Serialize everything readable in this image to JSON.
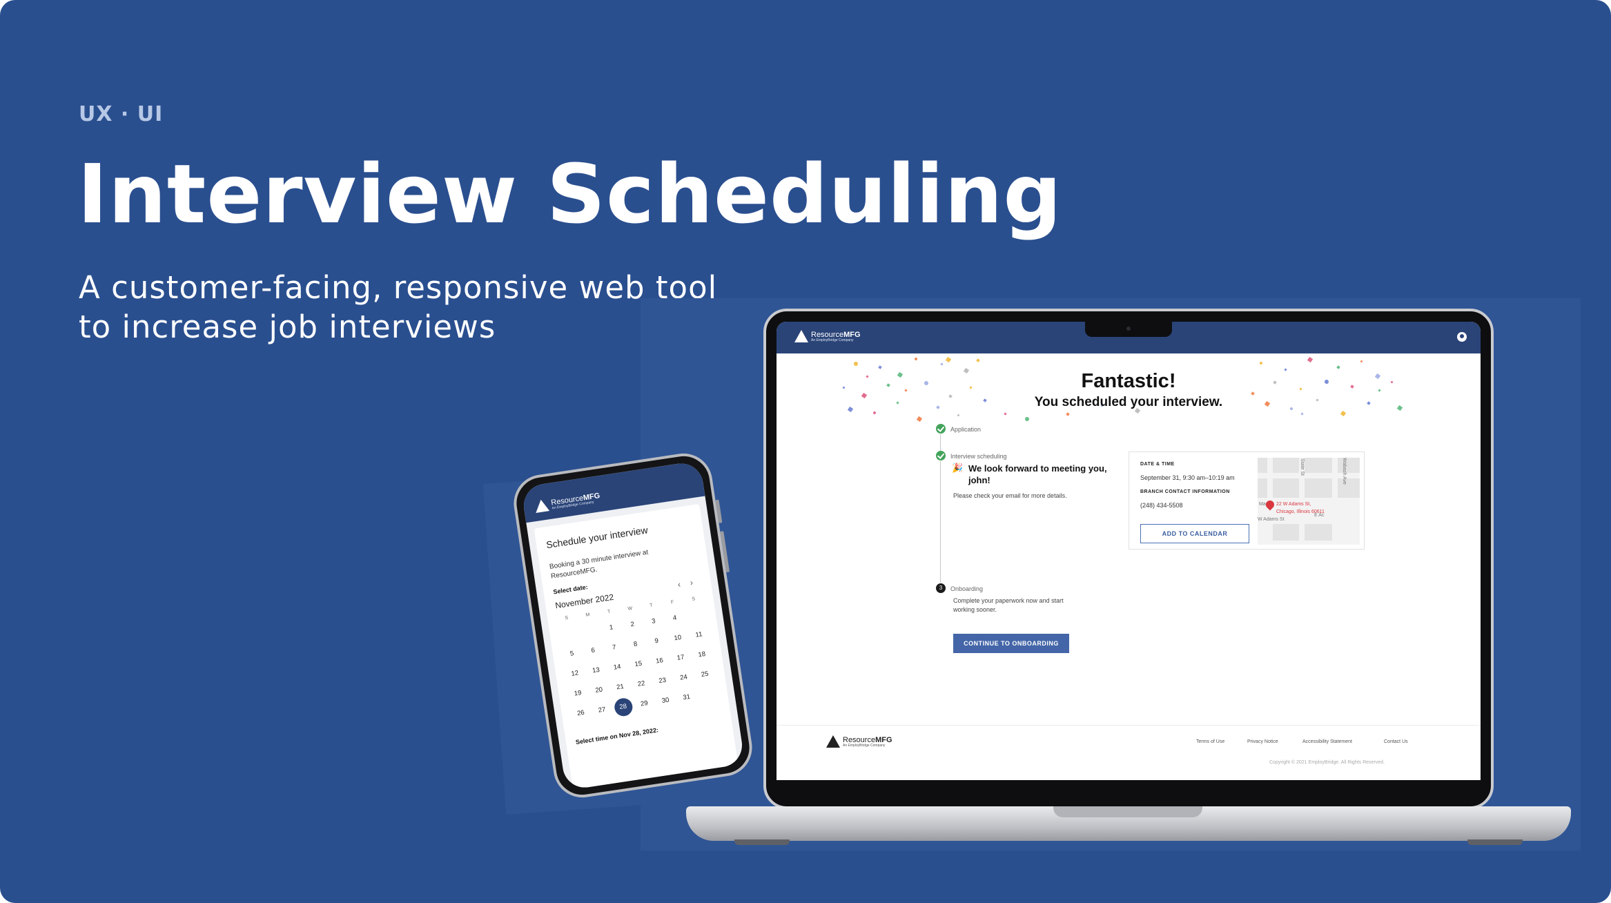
{
  "hero": {
    "eyebrow": "UX · UI",
    "title": "Interview Scheduling",
    "subtitle_line1": "A customer-facing, responsive web tool",
    "subtitle_line2": "to increase job interviews"
  },
  "brand": {
    "name_light": "Resource",
    "name_bold": "MFG",
    "tagline": "An EmployBridge Company"
  },
  "desktop": {
    "heading": "Fantastic!",
    "subheading": "You scheduled your interview.",
    "steps": [
      {
        "label": "Application"
      },
      {
        "label": "Interview scheduling"
      },
      {
        "label": "Onboarding"
      }
    ],
    "onboarding_step_number": "3",
    "meeting_message": "We look forward to meeting you, john!",
    "email_note": "Please check your email for more details.",
    "card": {
      "date_label": "DATE & TIME",
      "date_value": "September 31, 9:30 am–10:19 am",
      "contact_label": "BRANCH CONTACT INFORMATION",
      "phone": "(248) 434-5508",
      "calendar_button": "ADD TO CALENDAR"
    },
    "map": {
      "street1": "State St",
      "street2": "Wabash Ave",
      "street3": "W Adams St",
      "street4": "E Ac",
      "street5": "Marke",
      "address_line1": "22 W Adams St,",
      "address_line2": "Chicago, Illinois 60611"
    },
    "onboarding_text": "Complete your paperwork now and start working sooner.",
    "onboarding_button": "CONTINUE TO ONBOARDING",
    "footer": {
      "links": [
        "Terms of Use",
        "Privacy Notice",
        "Accessibility Statement",
        "Contact Us"
      ],
      "copyright": "Copyright © 2021 EmployBridge. All Rights Reserved."
    }
  },
  "mobile": {
    "title": "Schedule your interview",
    "description": "Booking a 30 minute interview at ResourceMFG.",
    "select_date_label": "Select date:",
    "month": "November 2022",
    "weekdays": [
      "S",
      "M",
      "T",
      "W",
      "T",
      "F",
      "S"
    ],
    "weeks": [
      [
        "",
        "",
        "1",
        "2",
        "3",
        "4",
        ""
      ],
      [
        "5",
        "6",
        "7",
        "8",
        "9",
        "10",
        "11"
      ],
      [
        "12",
        "13",
        "14",
        "15",
        "16",
        "17",
        "18"
      ],
      [
        "19",
        "20",
        "21",
        "22",
        "23",
        "24",
        "25"
      ],
      [
        "26",
        "27",
        "28",
        "29",
        "30",
        "31",
        ""
      ]
    ],
    "selected_day": "28",
    "select_time_label": "Select time on Nov 28, 2022:"
  },
  "colors": {
    "background": "#2a4f8f",
    "header_navy": "#2a4478",
    "button_blue": "#4466a8",
    "success_green": "#43a35b",
    "pin_red": "#d9363e"
  }
}
